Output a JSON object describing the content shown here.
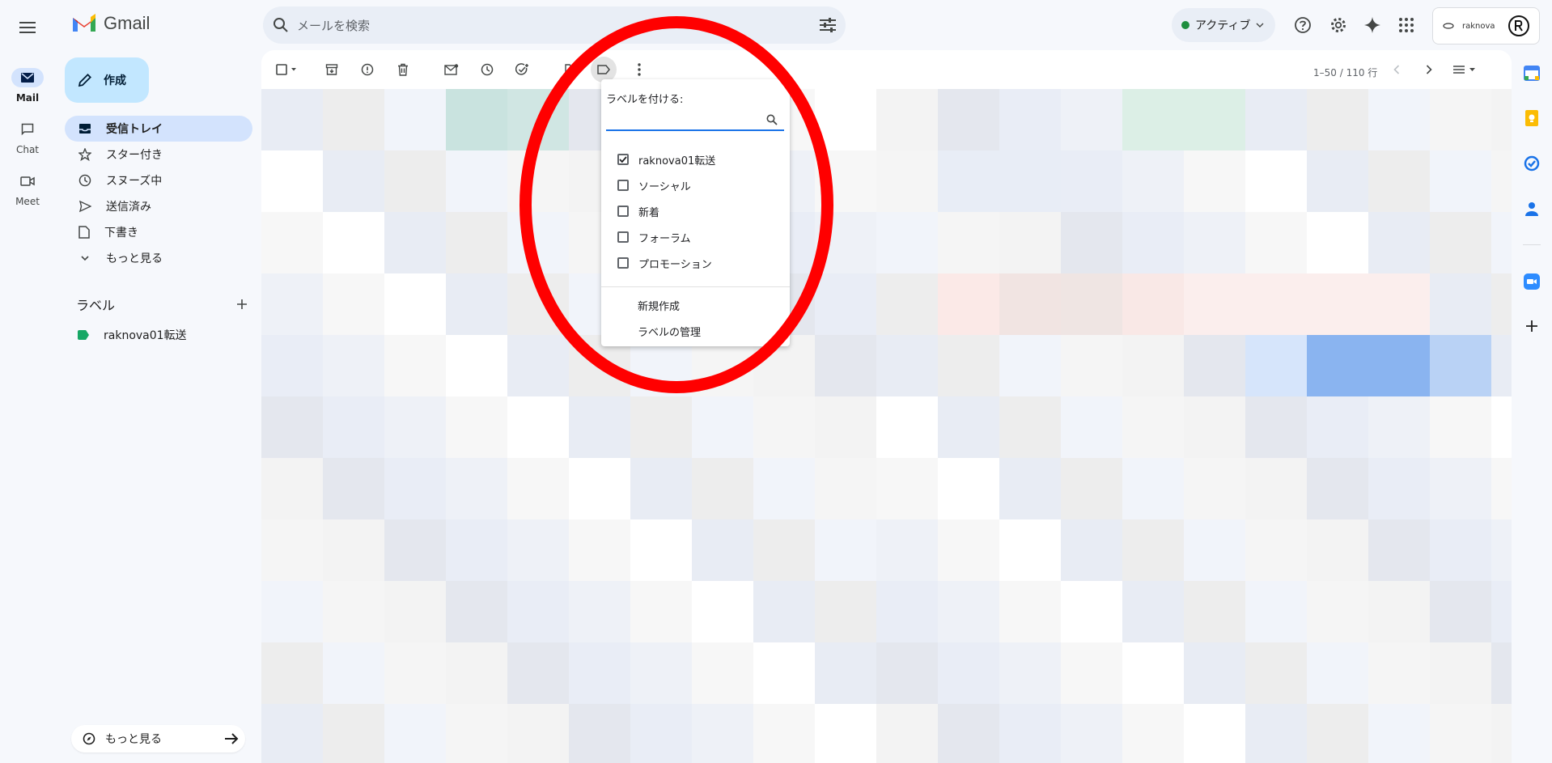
{
  "rail": {
    "items": [
      {
        "label": "Mail",
        "icon": "mail-icon",
        "active": true
      },
      {
        "label": "Chat",
        "icon": "chat-icon",
        "active": false
      },
      {
        "label": "Meet",
        "icon": "meet-icon",
        "active": false
      }
    ]
  },
  "header": {
    "app_name": "Gmail",
    "search_placeholder": "メールを検索",
    "status_label": "アクティブ",
    "account_name": "raknova"
  },
  "nav": {
    "compose_label": "作成",
    "items": [
      {
        "label": "受信トレイ",
        "icon": "inbox-icon",
        "active": true
      },
      {
        "label": "スター付き",
        "icon": "star-icon"
      },
      {
        "label": "スヌーズ中",
        "icon": "clock-icon"
      },
      {
        "label": "送信済み",
        "icon": "send-icon"
      },
      {
        "label": "下書き",
        "icon": "draft-icon"
      },
      {
        "label": "もっと見る",
        "icon": "chevron-down-icon"
      }
    ],
    "labels_heading": "ラベル",
    "labels": [
      {
        "label": "raknova01転送",
        "color": "#16a765"
      }
    ],
    "bottom_more": "もっと見る"
  },
  "toolbar": {
    "pager": "1–50 / 110 行"
  },
  "label_popup": {
    "title": "ラベルを付ける:",
    "options": [
      {
        "label": "raknova01転送",
        "checked": true
      },
      {
        "label": "ソーシャル",
        "checked": false
      },
      {
        "label": "新着",
        "checked": false
      },
      {
        "label": "フォーラム",
        "checked": false
      },
      {
        "label": "プロモーション",
        "checked": false
      }
    ],
    "actions": [
      "新規作成",
      "ラベルの管理"
    ]
  },
  "annotation": {
    "color": "#ff0000",
    "shape": "ellipse"
  },
  "colors": {
    "accent": "#1a73e8",
    "compose": "#c2e7ff",
    "active_nav": "#d3e3fd"
  }
}
